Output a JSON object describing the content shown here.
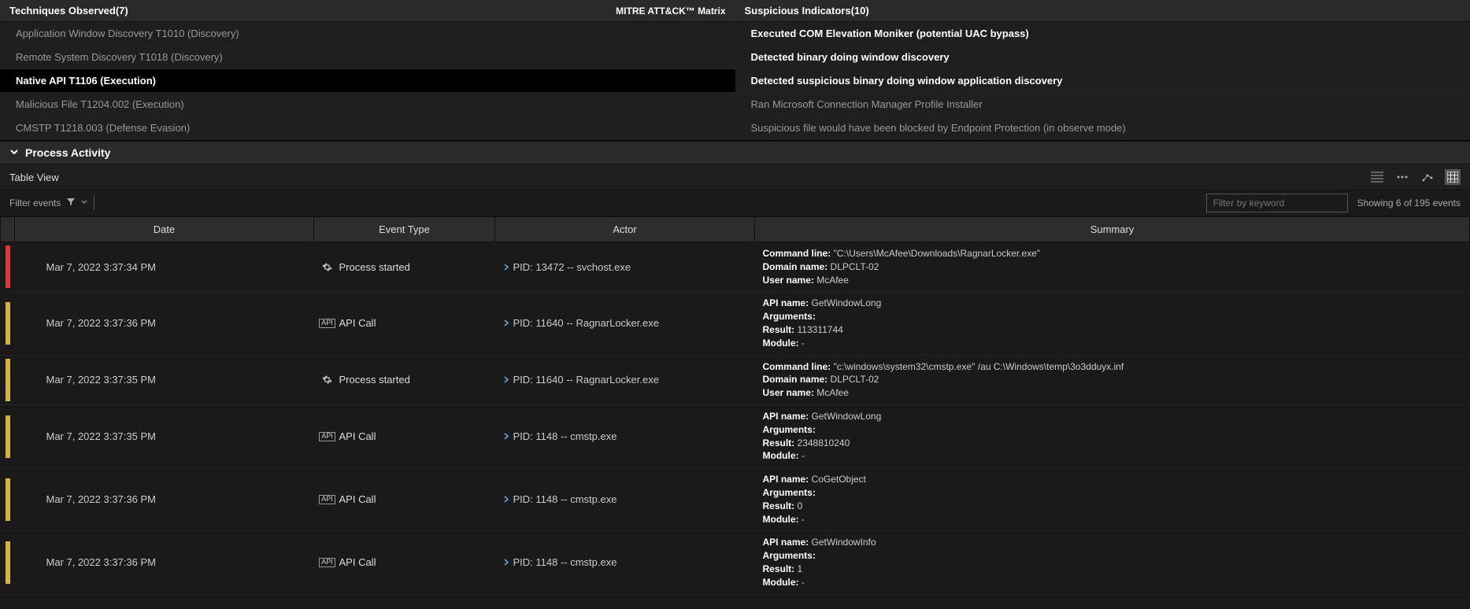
{
  "top": {
    "techniques": {
      "header": "Techniques Observed(7)",
      "header_right": "MITRE ATT&CK™ Matrix",
      "items": [
        {
          "label": "Application Window Discovery T1010 (Discovery)",
          "selected": false,
          "bold": false
        },
        {
          "label": "Remote System Discovery T1018 (Discovery)",
          "selected": false,
          "bold": false
        },
        {
          "label": "Native API T1106 (Execution)",
          "selected": true,
          "bold": true
        },
        {
          "label": "Malicious File T1204.002 (Execution)",
          "selected": false,
          "bold": false
        },
        {
          "label": "CMSTP T1218.003 (Defense Evasion)",
          "selected": false,
          "bold": false
        }
      ]
    },
    "indicators": {
      "header": "Suspicious Indicators(10)",
      "items": [
        {
          "label": "Executed COM Elevation Moniker (potential UAC bypass)",
          "bold": true
        },
        {
          "label": "Detected binary doing window discovery",
          "bold": true
        },
        {
          "label": "Detected suspicious binary doing window application discovery",
          "bold": true
        },
        {
          "label": "Ran Microsoft Connection Manager Profile Installer",
          "bold": false
        },
        {
          "label": "Suspicious file would have been blocked by Endpoint Protection (in observe mode)",
          "bold": false
        }
      ]
    }
  },
  "section_title": "Process Activity",
  "table_view_label": "Table View",
  "filter": {
    "label": "Filter events",
    "keyword_placeholder": "Filter by keyword",
    "count_text": "Showing 6 of 195 events"
  },
  "columns": {
    "date": "Date",
    "event_type": "Event Type",
    "actor": "Actor",
    "summary": "Summary"
  },
  "rows": [
    {
      "sev": "red",
      "date": "Mar 7, 2022 3:37:34 PM",
      "type": {
        "icon": "gear",
        "label": "Process started"
      },
      "actor": "PID: 13472 -- svchost.exe",
      "summary": [
        {
          "k": "Command line:",
          "v": "\"C:\\Users\\McAfee\\Downloads\\RagnarLocker.exe\""
        },
        {
          "k": "Domain name:",
          "v": "DLPCLT-02"
        },
        {
          "k": "User name:",
          "v": "McAfee"
        }
      ]
    },
    {
      "sev": "yellow",
      "date": "Mar 7, 2022 3:37:36 PM",
      "type": {
        "icon": "api",
        "label": "API Call"
      },
      "actor": "PID: 11640 -- RagnarLocker.exe",
      "summary": [
        {
          "k": "API name:",
          "v": "GetWindowLong"
        },
        {
          "k": "Arguments:",
          "v": ""
        },
        {
          "k": "Result:",
          "v": "113311744"
        },
        {
          "k": "Module:",
          "v": "-"
        }
      ]
    },
    {
      "sev": "yellow",
      "date": "Mar 7, 2022 3:37:35 PM",
      "type": {
        "icon": "gear",
        "label": "Process started"
      },
      "actor": "PID: 11640 -- RagnarLocker.exe",
      "summary": [
        {
          "k": "Command line:",
          "v": "\"c:\\windows\\system32\\cmstp.exe\" /au C:\\Windows\\temp\\3o3dduyx.inf"
        },
        {
          "k": "Domain name:",
          "v": "DLPCLT-02"
        },
        {
          "k": "User name:",
          "v": "McAfee"
        }
      ]
    },
    {
      "sev": "yellow",
      "date": "Mar 7, 2022 3:37:35 PM",
      "type": {
        "icon": "api",
        "label": "API Call"
      },
      "actor": "PID: 1148 -- cmstp.exe",
      "summary": [
        {
          "k": "API name:",
          "v": "GetWindowLong"
        },
        {
          "k": "Arguments:",
          "v": ""
        },
        {
          "k": "Result:",
          "v": "2348810240"
        },
        {
          "k": "Module:",
          "v": "-"
        }
      ]
    },
    {
      "sev": "yellow",
      "date": "Mar 7, 2022 3:37:36 PM",
      "type": {
        "icon": "api",
        "label": "API Call"
      },
      "actor": "PID: 1148 -- cmstp.exe",
      "summary": [
        {
          "k": "API name:",
          "v": "CoGetObject"
        },
        {
          "k": "Arguments:",
          "v": ""
        },
        {
          "k": "Result:",
          "v": "0"
        },
        {
          "k": "Module:",
          "v": "-"
        }
      ]
    },
    {
      "sev": "yellow",
      "date": "Mar 7, 2022 3:37:36 PM",
      "type": {
        "icon": "api",
        "label": "API Call"
      },
      "actor": "PID: 1148 -- cmstp.exe",
      "summary": [
        {
          "k": "API name:",
          "v": "GetWindowInfo"
        },
        {
          "k": "Arguments:",
          "v": ""
        },
        {
          "k": "Result:",
          "v": "1"
        },
        {
          "k": "Module:",
          "v": "-"
        }
      ]
    }
  ]
}
